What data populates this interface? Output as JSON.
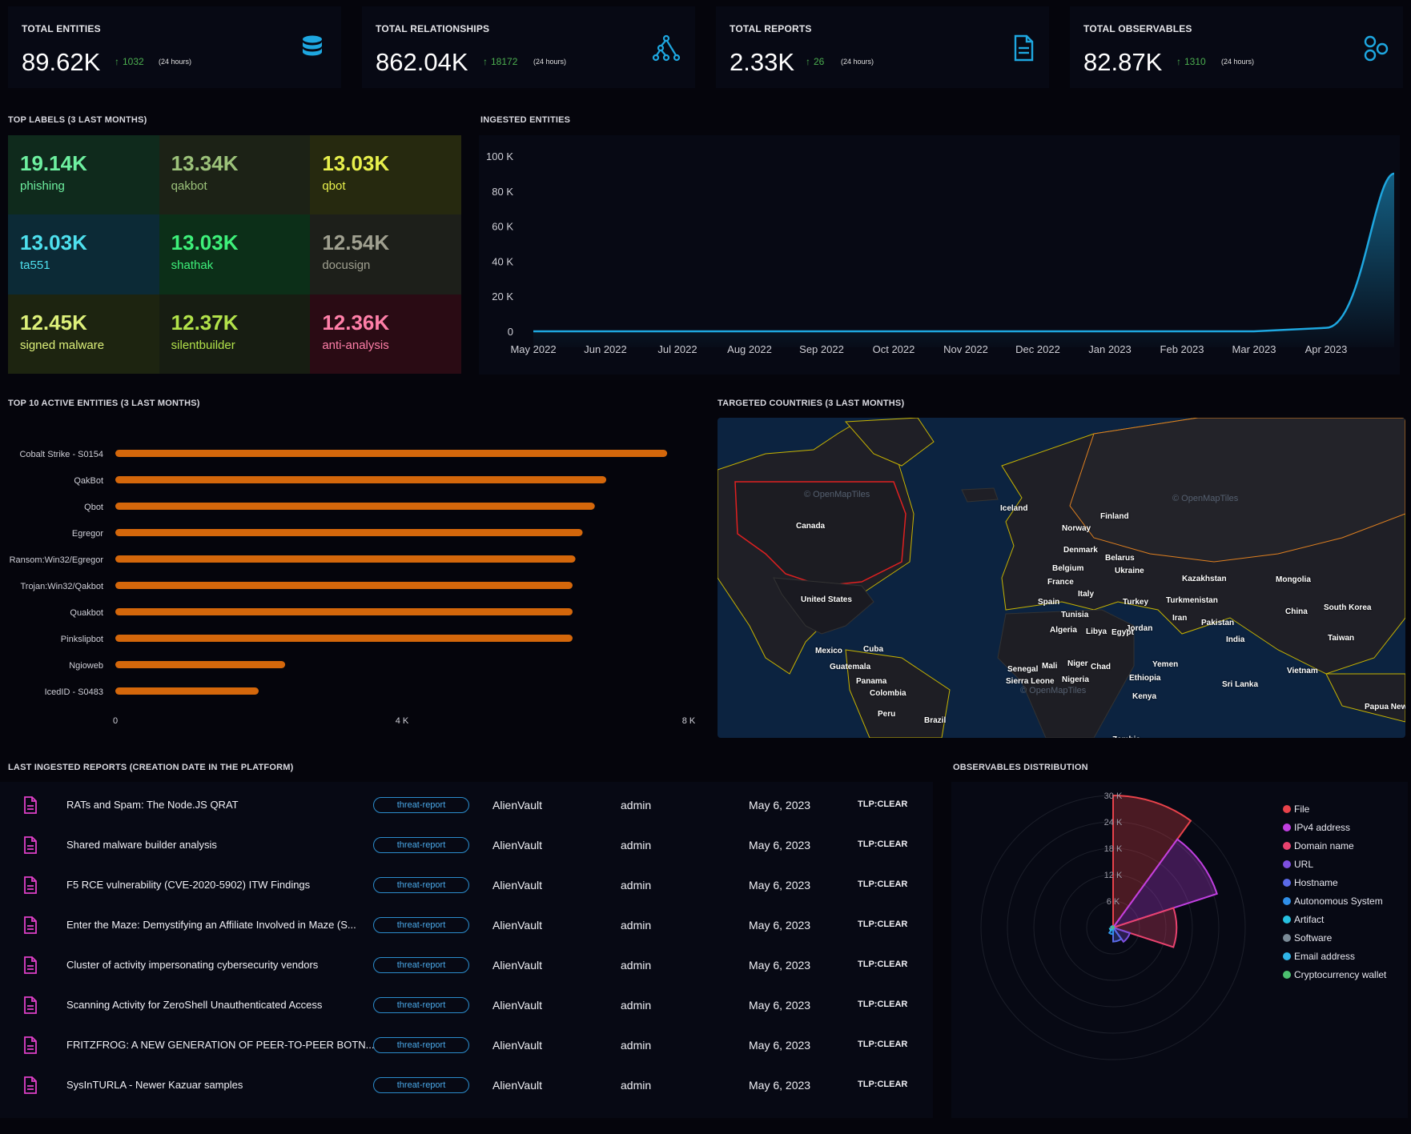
{
  "stats": [
    {
      "title": "TOTAL ENTITIES",
      "value": "89.62K",
      "delta": "1032",
      "period": "(24 hours)",
      "icon": "database-icon"
    },
    {
      "title": "TOTAL RELATIONSHIPS",
      "value": "862.04K",
      "delta": "18172",
      "period": "(24 hours)",
      "icon": "relationships-graph-icon"
    },
    {
      "title": "TOTAL REPORTS",
      "value": "2.33K",
      "delta": "26",
      "period": "(24 hours)",
      "icon": "report-document-icon"
    },
    {
      "title": "TOTAL OBSERVABLES",
      "value": "82.87K",
      "delta": "1310",
      "period": "(24 hours)",
      "icon": "observables-hexagons-icon"
    }
  ],
  "sections": {
    "top_labels": "TOP LABELS (3 LAST MONTHS)",
    "ingested_entities": "INGESTED ENTITIES",
    "top_active": "TOP 10 ACTIVE ENTITIES (3 LAST MONTHS)",
    "targeted_countries": "TARGETED COUNTRIES (3 LAST MONTHS)",
    "last_reports": "LAST INGESTED REPORTS (CREATION DATE IN THE PLATFORM)",
    "observables_distribution": "OBSERVABLES DISTRIBUTION"
  },
  "top_labels": [
    {
      "value": "19.14K",
      "name": "phishing",
      "color": "#6ef0a0",
      "bg": "#0f2a1c"
    },
    {
      "value": "13.34K",
      "name": "qakbot",
      "color": "#9cc27a",
      "bg": "#1c2216"
    },
    {
      "value": "13.03K",
      "name": "qbot",
      "color": "#e8f04c",
      "bg": "#26290f"
    },
    {
      "value": "13.03K",
      "name": "ta551",
      "color": "#4ee0ee",
      "bg": "#0c2a36"
    },
    {
      "value": "13.03K",
      "name": "shathak",
      "color": "#3ef07a",
      "bg": "#0c2f18"
    },
    {
      "value": "12.54K",
      "name": "docusign",
      "color": "#a0a090",
      "bg": "#1d1f1a"
    },
    {
      "value": "12.45K",
      "name": "signed malware",
      "color": "#ddf07a",
      "bg": "#1d2410"
    },
    {
      "value": "12.37K",
      "name": "silentbuilder",
      "color": "#b2e24a",
      "bg": "#171d12"
    },
    {
      "value": "12.36K",
      "name": "anti-analysis",
      "color": "#ff7fa8",
      "bg": "#2a0b14"
    }
  ],
  "chart_data": [
    {
      "type": "area",
      "title": "INGESTED ENTITIES",
      "x": [
        "May 2022",
        "Jun 2022",
        "Jul 2022",
        "Aug 2022",
        "Sep 2022",
        "Oct 2022",
        "Nov 2022",
        "Dec 2022",
        "Jan 2023",
        "Feb 2023",
        "Mar 2023",
        "Apr 2023",
        "May 2023"
      ],
      "values": [
        0,
        0,
        0,
        0,
        0,
        0,
        0,
        0,
        0,
        0,
        0,
        2000,
        90000
      ],
      "yticks": [
        "100 K",
        "80 K",
        "60 K",
        "40 K",
        "20 K",
        "0"
      ],
      "ylim": [
        0,
        100000
      ],
      "color": "#1ea7e0"
    },
    {
      "type": "bar",
      "title": "TOP 10 ACTIVE ENTITIES (3 LAST MONTHS)",
      "orientation": "horizontal",
      "categories": [
        "Cobalt Strike - S0154",
        "QakBot",
        "Qbot",
        "Egregor",
        "Ransom:Win32/Egregor",
        "Trojan:Win32/Qakbot",
        "Quakbot",
        "Pinkslipbot",
        "Ngioweb",
        "IcedID - S0483"
      ],
      "values": [
        7700,
        6850,
        6690,
        6520,
        6420,
        6380,
        6380,
        6380,
        2370,
        2000
      ],
      "xticks": [
        "0",
        "4 K",
        "8 K"
      ],
      "xlim": [
        0,
        8000
      ],
      "color": "#d4670b"
    },
    {
      "type": "polar-area",
      "title": "OBSERVABLES DISTRIBUTION",
      "rticks": [
        "30 K",
        "24 K",
        "18 K",
        "12 K",
        "6 K"
      ],
      "rlim": [
        0,
        30000
      ],
      "categories": [
        "File",
        "IPv4 address",
        "Domain name",
        "URL",
        "Hostname",
        "Autonomous System",
        "Artifact",
        "Software",
        "Email address",
        "Cryptocurrency wallet"
      ],
      "values": [
        30000,
        24800,
        14400,
        4000,
        3200,
        1500,
        800,
        500,
        400,
        200
      ],
      "colors": [
        "#e8424a",
        "#c03fe0",
        "#e8426e",
        "#7e4fe0",
        "#5a6ae8",
        "#2f8fe8",
        "#26c0e0",
        "#7a8a96",
        "#2fb4e8",
        "#4cc070"
      ]
    }
  ],
  "map": {
    "attribution": "© OpenMapTiles",
    "countries": [
      "Iceland",
      "Canada",
      "Norway",
      "Finland",
      "Denmark",
      "Belarus",
      "Belgium",
      "Ukraine",
      "France",
      "Kazakhstan",
      "Mongolia",
      "Italy",
      "Spain",
      "Turkey",
      "Turkmenistan",
      "United States",
      "Tunisia",
      "Jordan",
      "Iran",
      "China",
      "South Korea",
      "Pakistan",
      "Algeria",
      "Libya",
      "Egypt",
      "India",
      "Taiwan",
      "Mexico",
      "Cuba",
      "Guatemala",
      "Senegal",
      "Mali",
      "Niger",
      "Chad",
      "Yemen",
      "Vietnam",
      "Sierra Leone",
      "Nigeria",
      "Ethiopia",
      "Panama",
      "Sri Lanka",
      "Colombia",
      "Kenya",
      "Papua New Guinea",
      "Peru",
      "Brazil",
      "Zambia"
    ]
  },
  "reports": {
    "tag": "threat-report",
    "rows": [
      {
        "title": "RATs and Spam: The Node.JS QRAT",
        "author": "AlienVault",
        "creator": "admin",
        "date": "May 6, 2023",
        "marking": "TLP:CLEAR"
      },
      {
        "title": "Shared malware builder analysis",
        "author": "AlienVault",
        "creator": "admin",
        "date": "May 6, 2023",
        "marking": "TLP:CLEAR"
      },
      {
        "title": "F5 RCE vulnerability (CVE-2020-5902) ITW Findings",
        "author": "AlienVault",
        "creator": "admin",
        "date": "May 6, 2023",
        "marking": "TLP:CLEAR"
      },
      {
        "title": "Enter the Maze: Demystifying an Affiliate Involved in Maze (S...",
        "author": "AlienVault",
        "creator": "admin",
        "date": "May 6, 2023",
        "marking": "TLP:CLEAR"
      },
      {
        "title": "Cluster of activity impersonating cybersecurity vendors",
        "author": "AlienVault",
        "creator": "admin",
        "date": "May 6, 2023",
        "marking": "TLP:CLEAR"
      },
      {
        "title": "Scanning Activity for ZeroShell Unauthenticated Access",
        "author": "AlienVault",
        "creator": "admin",
        "date": "May 6, 2023",
        "marking": "TLP:CLEAR"
      },
      {
        "title": "FRITZFROG: A NEW GENERATION OF PEER-TO-PEER BOTN...",
        "author": "AlienVault",
        "creator": "admin",
        "date": "May 6, 2023",
        "marking": "TLP:CLEAR"
      },
      {
        "title": "SysInTURLA - Newer Kazuar samples",
        "author": "AlienVault",
        "creator": "admin",
        "date": "May 6, 2023",
        "marking": "TLP:CLEAR"
      }
    ]
  },
  "colors": {
    "accent": "#1ea7e0",
    "delta": "#4caf50",
    "report_icon": "#e040c8"
  }
}
